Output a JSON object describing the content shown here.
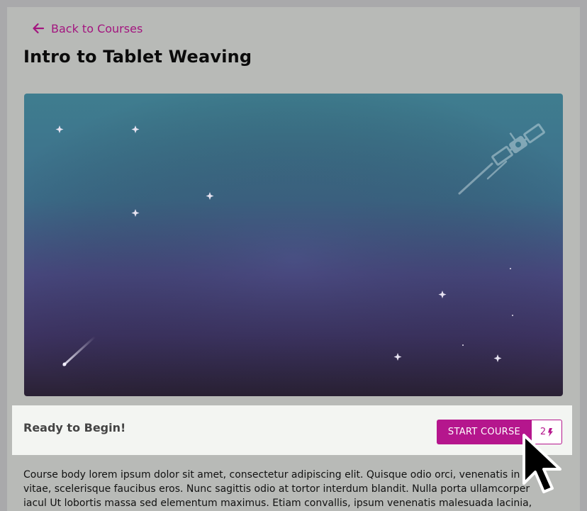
{
  "nav": {
    "back_label": "Back to Courses"
  },
  "course": {
    "title": "Intro to Tablet Weaving",
    "ready_label": "Ready to Begin!",
    "start_label": "START COURSE",
    "credits": "2",
    "credit_icon": "lightning-icon"
  },
  "body_text": "Course body lorem ipsum dolor sit amet, consectetur adipiscing elit. Quisque odio orci, venenatis in ar vitae, scelerisque faucibus eros. Nunc sagittis odio at tortor interdum blandit. Nulla porta ullamcorper iacul Ut lobortis massa sed elementum maximus. Etiam convallis, ipsum venenatis malesuada lacinia, elit ipsum",
  "colors": {
    "accent": "#b5168d",
    "link": "#a3157f",
    "page_bg": "#b8bab7",
    "bar_bg": "#f3f5f2"
  },
  "icons": {
    "back": "arrow-left-icon",
    "hero": "space-satellite-illustration",
    "cursor": "mouse-pointer"
  }
}
